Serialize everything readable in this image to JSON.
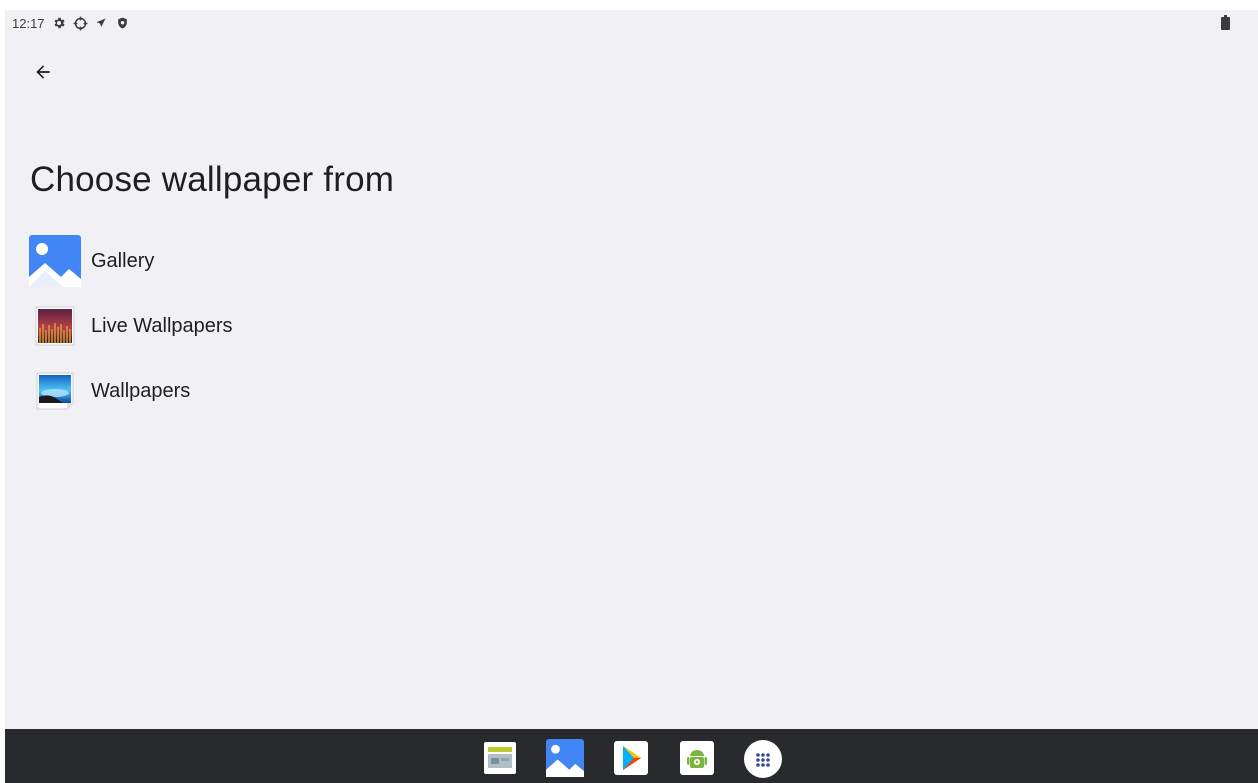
{
  "status_bar": {
    "time": "12:17",
    "icons": [
      "settings-gear-icon",
      "crosshair-icon",
      "location-arrow-icon",
      "shield-icon"
    ],
    "battery_icon": "battery-icon"
  },
  "header": {
    "back_icon": "arrow-back-icon"
  },
  "page": {
    "title": "Choose wallpaper from",
    "options": [
      {
        "label": "Gallery",
        "icon": "gallery-icon"
      },
      {
        "label": "Live Wallpapers",
        "icon": "live-wallpapers-icon"
      },
      {
        "label": "Wallpapers",
        "icon": "wallpapers-icon"
      }
    ]
  },
  "taskbar": {
    "apps": [
      "app-icon-1",
      "gallery-icon",
      "play-store-icon",
      "android-app-icon",
      "app-drawer-icon"
    ]
  },
  "colors": {
    "background": "#f1f0f5",
    "taskbar": "#292a2d",
    "gallery_blue": "#4285f4"
  }
}
